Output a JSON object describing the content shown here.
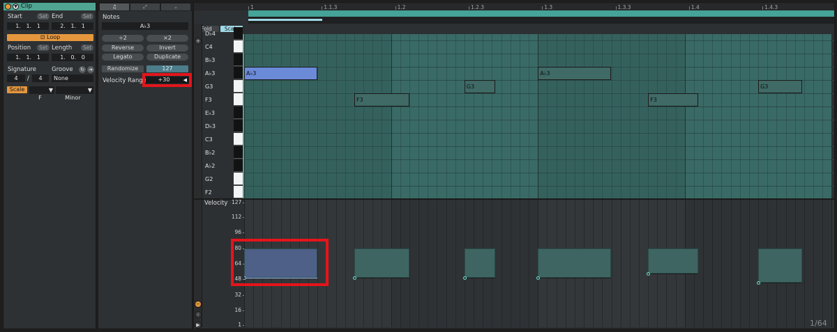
{
  "clip": {
    "title": "Clip",
    "start_label": "Start",
    "end_label": "End",
    "set_label": "Set",
    "start_value": "1.   1.   1",
    "end_value": "2.   1.   1",
    "loop_label": "Loop",
    "position_label": "Position",
    "length_label": "Length",
    "position_value": "1.   1.   1",
    "length_value": "1.   0.   0",
    "signature_label": "Signature",
    "groove_label": "Groove",
    "sig_numerator": "4",
    "sig_slash": "/",
    "sig_denominator": "4",
    "groove_value": "None",
    "scale_label": "Scale",
    "scale_root": "F",
    "scale_mode": "Minor"
  },
  "notes_panel": {
    "title": "Notes",
    "pitch_value": "A♭3",
    "div2": "÷2",
    "mul2": "×2",
    "reverse": "Reverse",
    "invert": "Invert",
    "legato": "Legato",
    "duplicate": "Duplicate",
    "randomize": "Randomize",
    "randomize_value": "127",
    "velocity_range_label": "Velocity Range",
    "velocity_range_value": "+30",
    "tabs": [
      "♫",
      "⤢",
      "⌄"
    ]
  },
  "editor": {
    "fold_label": "Fold",
    "scale_label": "Scale",
    "ruler": [
      "1",
      "1.1.3",
      "1.2",
      "1.2.3",
      "1.3",
      "1.3.3",
      "1.4",
      "1.4.3"
    ],
    "keys": [
      "D♭4",
      "C4",
      "B♭3",
      "A♭3",
      "G3",
      "F3",
      "E♭3",
      "D♭3",
      "C3",
      "B♭2",
      "A♭2",
      "G2",
      "F2"
    ],
    "velocity_label": "Velocity",
    "velocity_ticks": [
      "127",
      "112",
      "96",
      "80",
      "64",
      "48",
      "32",
      "16",
      "1"
    ],
    "zoom_label": "1/64"
  },
  "notes": [
    {
      "pitch": "A♭3",
      "start": 0.0,
      "length": 0.5,
      "velocity": 80,
      "selected": true
    },
    {
      "pitch": "F3",
      "start": 0.75,
      "length": 0.375,
      "velocity": 80,
      "selected": false
    },
    {
      "pitch": "G3",
      "start": 1.5,
      "length": 0.21,
      "velocity": 80,
      "selected": false
    },
    {
      "pitch": "A♭3",
      "start": 2.0,
      "length": 0.5,
      "velocity": 80,
      "selected": false
    },
    {
      "pitch": "F3",
      "start": 2.75,
      "length": 0.34,
      "velocity": 80,
      "selected": false
    },
    {
      "pitch": "G3",
      "start": 3.5,
      "length": 0.3,
      "velocity": 80,
      "selected": false
    }
  ],
  "velocity_ranges": [
    30,
    30,
    30,
    30,
    26,
    35
  ],
  "colors": {
    "accent": "#4fa592",
    "orange": "#e6973e",
    "selected_note": "#6b8bd9",
    "note": "#3f6a66",
    "highlight": "#e4151b"
  }
}
